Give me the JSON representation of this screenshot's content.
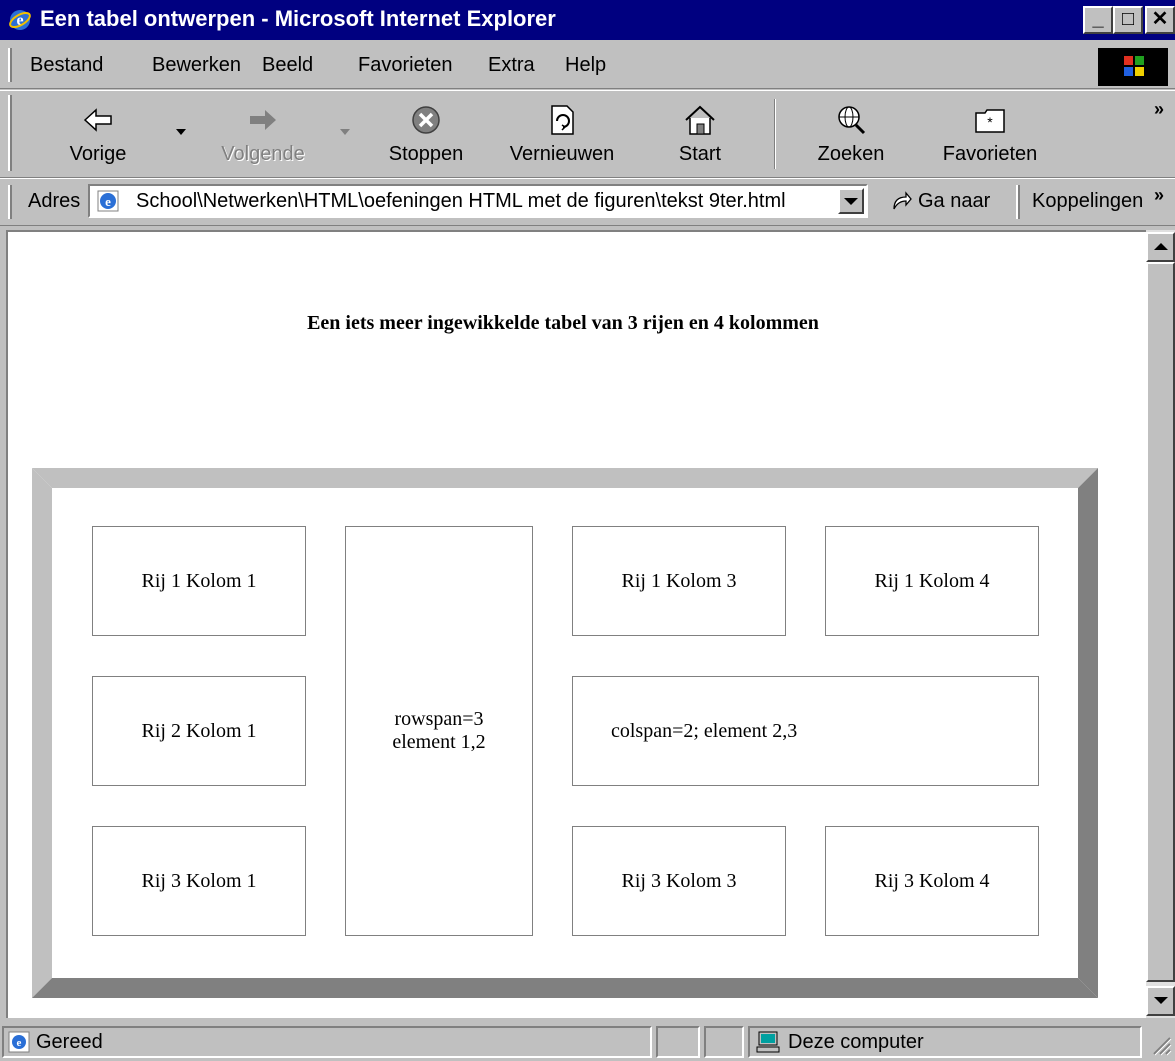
{
  "window": {
    "title": "Een tabel ontwerpen - Microsoft Internet Explorer",
    "minimize": "_",
    "maximize": "□",
    "close": "✕"
  },
  "menu": {
    "items": [
      {
        "label": "Bestand"
      },
      {
        "label": "Bewerken"
      },
      {
        "label": "Beeld"
      },
      {
        "label": "Favorieten"
      },
      {
        "label": "Extra"
      },
      {
        "label": "Help"
      }
    ]
  },
  "toolbar": {
    "back": "Vorige",
    "forward": "Volgende",
    "stop": "Stoppen",
    "refresh": "Vernieuwen",
    "home": "Start",
    "search": "Zoeken",
    "favorites": "Favorieten",
    "more": "»"
  },
  "address": {
    "label": "Adres",
    "value": "School\\Netwerken\\HTML\\oefeningen HTML met de figuren\\tekst 9ter.html",
    "go": "Ga naar",
    "links": "Koppelingen",
    "links_more": "»"
  },
  "page": {
    "heading": "Een iets meer ingewikkelde tabel van 3 rijen en 4 kolommen",
    "cells": {
      "r1c1": "Rij 1 Kolom 1",
      "r1c2_line1": "rowspan=3",
      "r1c2_line2": "element 1,2",
      "r1c3": "Rij 1 Kolom 3",
      "r1c4": "Rij 1 Kolom 4",
      "r2c1": "Rij 2 Kolom 1",
      "r2c3": "colspan=2; element 2,3",
      "r3c1": "Rij 3 Kolom 1",
      "r3c3": "Rij 3 Kolom 3",
      "r3c4": "Rij 3 Kolom 4"
    }
  },
  "status": {
    "text": "Gereed",
    "zone": "Deze computer"
  },
  "colors": {
    "titlebar": "#000080",
    "face": "#c0c0c0",
    "border_light": "#c0c0c0",
    "border_dark": "#808080"
  }
}
